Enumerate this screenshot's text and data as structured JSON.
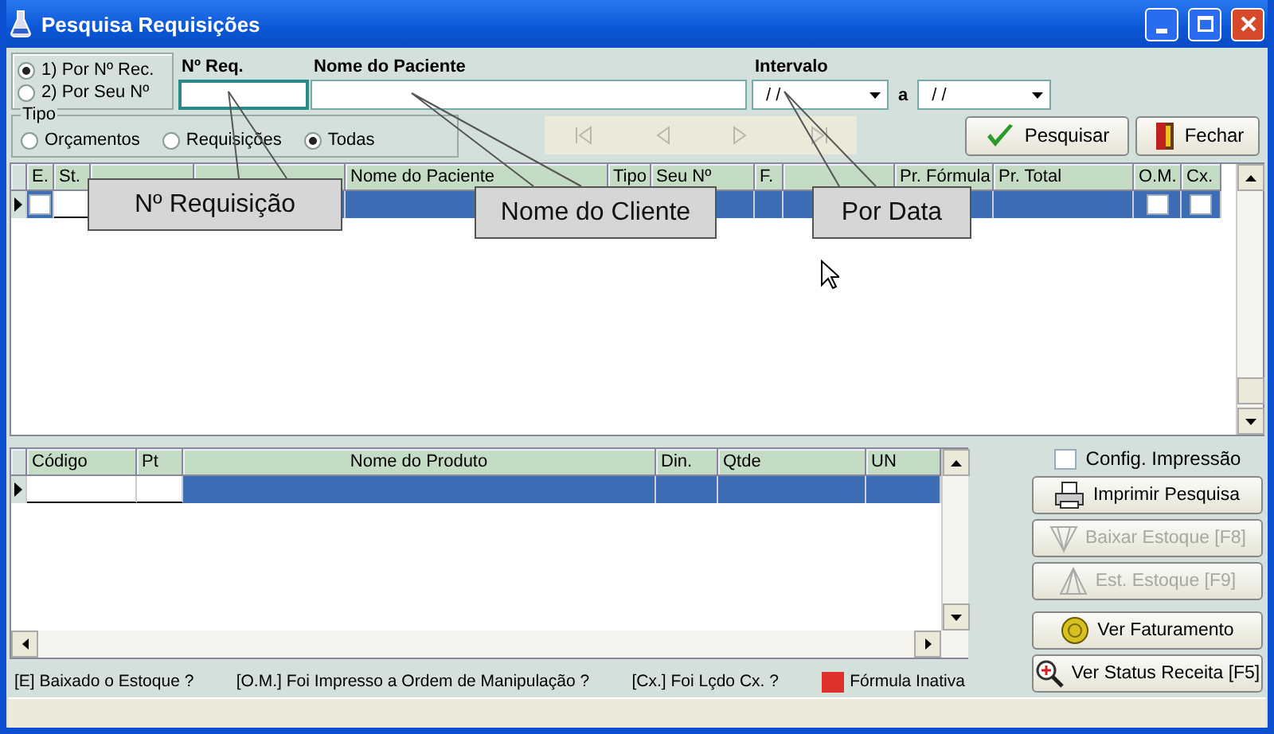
{
  "window": {
    "title": "Pesquisa Requisições"
  },
  "search_mode": [
    {
      "label": "1) Por Nº Rec.",
      "selected": true
    },
    {
      "label": "2) Por Seu Nº",
      "selected": false
    }
  ],
  "filters": {
    "request_label": "Nº Req.",
    "patient_label": "Nome do Paciente",
    "interval_label": "Intervalo",
    "date_from": "/ /",
    "date_separator": "a",
    "date_to": "/ /"
  },
  "tipo": {
    "label": "Tipo",
    "options": [
      {
        "label": "Orçamentos",
        "selected": false
      },
      {
        "label": "Requisições",
        "selected": false
      },
      {
        "label": "Todas",
        "selected": true
      }
    ]
  },
  "navigator": {
    "disabled": true
  },
  "buttons": [
    {
      "label": "Pesquisar"
    },
    {
      "label": "Fechar"
    }
  ],
  "requests_table": {
    "columns": [
      {
        "label": "E.",
        "kind": "check"
      },
      {
        "label": "St.",
        "kind": "text",
        "editable": true
      },
      {
        "kind": "text"
      },
      {
        "kind": "text"
      },
      {
        "label": "Nome do Paciente",
        "kind": "text"
      },
      {
        "label": "Tipo",
        "kind": "text"
      },
      {
        "label": "Seu Nº",
        "kind": "text"
      },
      {
        "label": "F.",
        "kind": "text"
      },
      {
        "kind": "text"
      },
      {
        "label": "Pr. Fórmula",
        "kind": "text"
      },
      {
        "label": "Pr. Total",
        "kind": "text"
      },
      {
        "label": "O.M.",
        "kind": "check"
      },
      {
        "label": "Cx.",
        "kind": "check"
      }
    ],
    "rows": [
      {
        "selected": true,
        "checks": [
          false,
          false,
          false
        ]
      }
    ]
  },
  "products_table": {
    "columns": [
      {
        "label": "Código",
        "kind": "text",
        "editable": true
      },
      {
        "label": "Pt",
        "kind": "text",
        "editable": true
      },
      {
        "label": "Nome do Produto",
        "kind": "text"
      },
      {
        "label": "Din.",
        "kind": "text"
      },
      {
        "label": "Qtde",
        "kind": "text"
      },
      {
        "label": "UN",
        "kind": "text"
      }
    ],
    "rows": [
      {
        "selected": true,
        "checks": []
      }
    ]
  },
  "callouts": [
    {
      "text": "Nº Requisição"
    },
    {
      "text": "Nome do Cliente"
    },
    {
      "text": "Por Data"
    }
  ],
  "print_config": {
    "label": "Config. Impressão",
    "checked": false
  },
  "actions": [
    {
      "label": "Imprimir Pesquisa",
      "disabled": false
    },
    {
      "label": "Baixar Estoque [F8]",
      "disabled": true
    },
    {
      "label": "Est. Estoque [F9]",
      "disabled": true
    },
    {
      "label": "Ver Faturamento",
      "disabled": false
    },
    {
      "label": "Ver Status Receita [F5]",
      "disabled": false
    }
  ],
  "legend": [
    {
      "text": "[E] Baixado o Estoque ?"
    },
    {
      "text": "[O.M.] Foi Impresso a Ordem de Manipulação ?"
    },
    {
      "text": "[Cx.] Foi Lçdo Cx. ?"
    },
    {
      "text": "Fórmula Inativa",
      "color": "#e0302c"
    }
  ]
}
